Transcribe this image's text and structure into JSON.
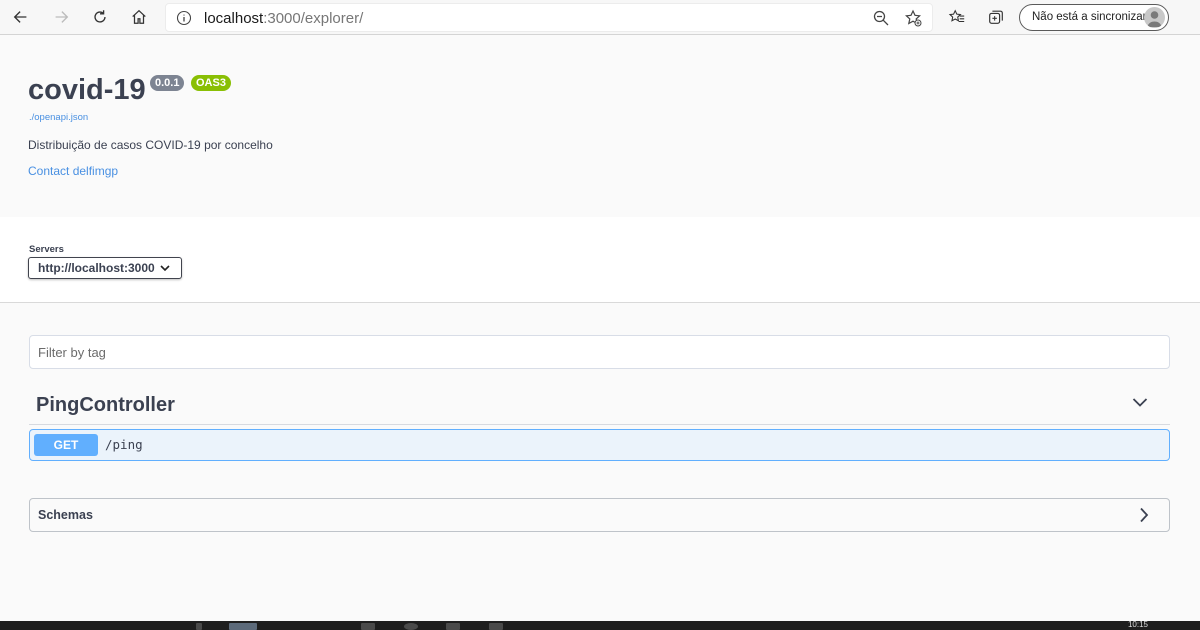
{
  "browser": {
    "url_host": "localhost",
    "url_rest": ":3000/explorer/",
    "sync_label": "Não está a sincronizar",
    "icons": [
      "back-icon",
      "forward-icon",
      "refresh-icon",
      "home-icon",
      "info-icon",
      "zoom-icon",
      "add-favorite-icon",
      "favorites-icon",
      "collections-icon",
      "profile-icon"
    ]
  },
  "info": {
    "title": "covid-19",
    "version": "0.0.1",
    "oas": "OAS3",
    "spec_link": "./openapi.json",
    "description": "Distribuição de casos COVID-19 por concelho",
    "contact": "Contact delfimgp"
  },
  "servers": {
    "label": "Servers",
    "selected": "http://localhost:3000"
  },
  "filter": {
    "placeholder": "Filter by tag"
  },
  "tags": [
    {
      "name": "PingController",
      "operations": [
        {
          "method": "GET",
          "path": "/ping"
        }
      ]
    }
  ],
  "schemas": {
    "title": "Schemas"
  },
  "taskbar": {
    "clock": "10:15"
  },
  "colors": {
    "get": "#61affe",
    "get_bg": "#ebf3fb",
    "oas": "#89bf04",
    "version": "#7d8492",
    "link": "#4990e2",
    "text": "#3b4151"
  }
}
